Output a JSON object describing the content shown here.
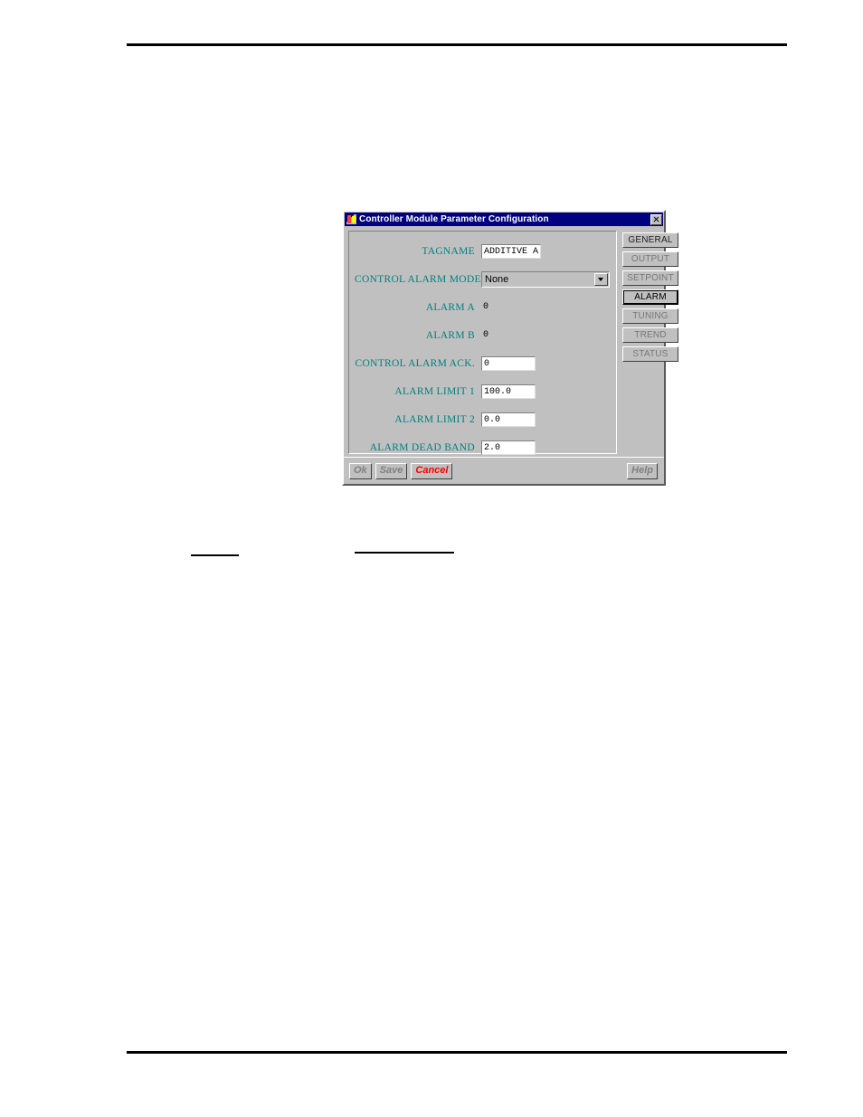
{
  "page": {
    "rules": {
      "top_rule": "horizontal-rule",
      "bottom_rule": "horizontal-rule",
      "note_rule_a": "short-rule",
      "note_rule_b": "short-rule"
    }
  },
  "dialog": {
    "title": "Controller Module Parameter Configuration",
    "title_icon": "application-icon",
    "close_icon": "close-icon",
    "fields": [
      {
        "label": "TAGNAME",
        "type": "text",
        "value": "ADDITIVE A",
        "name": "tagname"
      },
      {
        "label": "CONTROL ALARM MODE",
        "type": "select",
        "value": "None",
        "name": "control-alarm-mode"
      },
      {
        "label": "ALARM A",
        "type": "readonly",
        "value": "0",
        "name": "alarm-a"
      },
      {
        "label": "ALARM B",
        "type": "readonly",
        "value": "0",
        "name": "alarm-b"
      },
      {
        "label": "CONTROL ALARM ACK.",
        "type": "text",
        "value": "0",
        "name": "control-alarm-ack"
      },
      {
        "label": "ALARM LIMIT 1",
        "type": "text",
        "value": "100.0",
        "name": "alarm-limit-1"
      },
      {
        "label": "ALARM LIMIT 2",
        "type": "text",
        "value": "0.0",
        "name": "alarm-limit-2"
      },
      {
        "label": "ALARM DEAD BAND",
        "type": "text",
        "value": "2.0",
        "name": "alarm-dead-band"
      }
    ],
    "tabs": [
      {
        "label": "GENERAL",
        "selected": false,
        "emphasis": true
      },
      {
        "label": "OUTPUT",
        "selected": false,
        "emphasis": false
      },
      {
        "label": "SETPOINT",
        "selected": false,
        "emphasis": false
      },
      {
        "label": "ALARM",
        "selected": true,
        "emphasis": false
      },
      {
        "label": "TUNING",
        "selected": false,
        "emphasis": false
      },
      {
        "label": "TREND",
        "selected": false,
        "emphasis": false
      },
      {
        "label": "STATUS",
        "selected": false,
        "emphasis": false
      }
    ],
    "footer": {
      "ok_label": "Ok",
      "save_label": "Save",
      "cancel_label": "Cancel",
      "help_label": "Help"
    }
  },
  "colors": {
    "titlebar": "#000080",
    "face": "#c0c0c0",
    "label_teal": "#008080",
    "cancel_red": "#ff0000",
    "button_text": "#808080"
  }
}
